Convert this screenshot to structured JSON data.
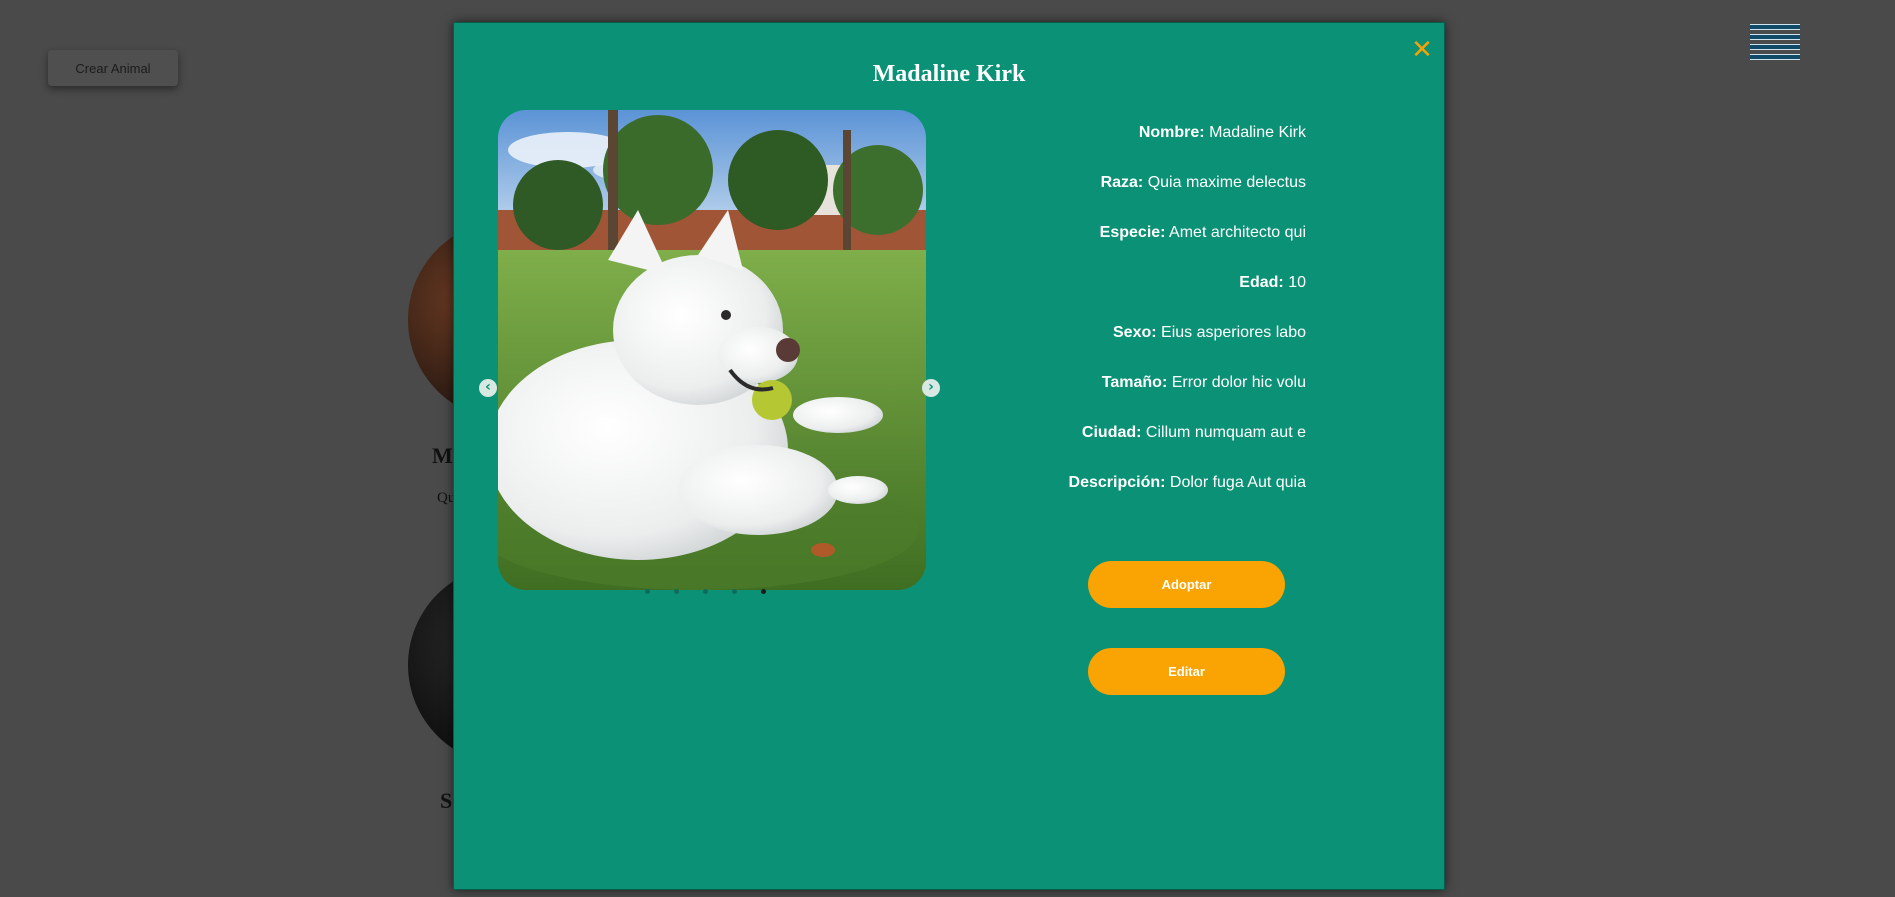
{
  "background": {
    "create_button": "Crear Animal",
    "card_1_name": "M",
    "card_1_sub": "Qu",
    "card_2_name": "S"
  },
  "modal": {
    "title": "Madaline Kirk",
    "close_symbol": "✕",
    "carousel": {
      "prev_symbol": "‹",
      "next_symbol": "›",
      "slide_count": 5,
      "active_slide": 5
    },
    "details": [
      {
        "label": "Nombre:",
        "value": "Madaline Kirk"
      },
      {
        "label": "Raza:",
        "value": "Quia maxime delectus"
      },
      {
        "label": "Especie:",
        "value": "Amet architecto qui"
      },
      {
        "label": "Edad:",
        "value": "10"
      },
      {
        "label": "Sexo:",
        "value": "Eius asperiores labo"
      },
      {
        "label": "Tamaño:",
        "value": "Error dolor hic volu"
      },
      {
        "label": "Ciudad:",
        "value": "Cillum numquam aut e"
      },
      {
        "label": "Descripción:",
        "value": "Dolor fuga Aut quia"
      }
    ],
    "adopt_button": "Adoptar",
    "edit_button": "Editar"
  },
  "colors": {
    "modal_bg": "#0b9175",
    "accent": "#f9a402",
    "overlay": "#4a4a4a"
  }
}
